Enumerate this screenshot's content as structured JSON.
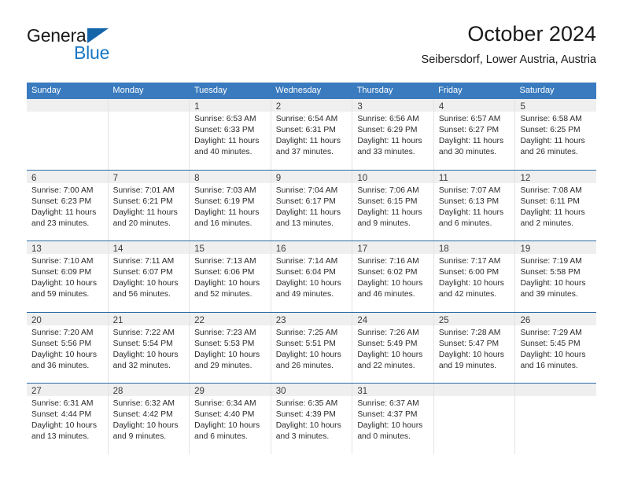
{
  "brand": {
    "name_part1": "General",
    "name_part2": "Blue",
    "accent_color": "#1777c4",
    "triangle_color": "#1464aa"
  },
  "header": {
    "title": "October 2024",
    "subtitle": "Seibersdorf, Lower Austria, Austria"
  },
  "calendar": {
    "header_bg": "#3a7bbf",
    "row_border_color": "#2d6ca8",
    "weekdays": [
      "Sunday",
      "Monday",
      "Tuesday",
      "Wednesday",
      "Thursday",
      "Friday",
      "Saturday"
    ],
    "weeks": [
      [
        {
          "day": "",
          "sunrise": "",
          "sunset": "",
          "daylight_line1": "",
          "daylight_line2": ""
        },
        {
          "day": "",
          "sunrise": "",
          "sunset": "",
          "daylight_line1": "",
          "daylight_line2": ""
        },
        {
          "day": "1",
          "sunrise": "Sunrise: 6:53 AM",
          "sunset": "Sunset: 6:33 PM",
          "daylight_line1": "Daylight: 11 hours",
          "daylight_line2": "and 40 minutes."
        },
        {
          "day": "2",
          "sunrise": "Sunrise: 6:54 AM",
          "sunset": "Sunset: 6:31 PM",
          "daylight_line1": "Daylight: 11 hours",
          "daylight_line2": "and 37 minutes."
        },
        {
          "day": "3",
          "sunrise": "Sunrise: 6:56 AM",
          "sunset": "Sunset: 6:29 PM",
          "daylight_line1": "Daylight: 11 hours",
          "daylight_line2": "and 33 minutes."
        },
        {
          "day": "4",
          "sunrise": "Sunrise: 6:57 AM",
          "sunset": "Sunset: 6:27 PM",
          "daylight_line1": "Daylight: 11 hours",
          "daylight_line2": "and 30 minutes."
        },
        {
          "day": "5",
          "sunrise": "Sunrise: 6:58 AM",
          "sunset": "Sunset: 6:25 PM",
          "daylight_line1": "Daylight: 11 hours",
          "daylight_line2": "and 26 minutes."
        }
      ],
      [
        {
          "day": "6",
          "sunrise": "Sunrise: 7:00 AM",
          "sunset": "Sunset: 6:23 PM",
          "daylight_line1": "Daylight: 11 hours",
          "daylight_line2": "and 23 minutes."
        },
        {
          "day": "7",
          "sunrise": "Sunrise: 7:01 AM",
          "sunset": "Sunset: 6:21 PM",
          "daylight_line1": "Daylight: 11 hours",
          "daylight_line2": "and 20 minutes."
        },
        {
          "day": "8",
          "sunrise": "Sunrise: 7:03 AM",
          "sunset": "Sunset: 6:19 PM",
          "daylight_line1": "Daylight: 11 hours",
          "daylight_line2": "and 16 minutes."
        },
        {
          "day": "9",
          "sunrise": "Sunrise: 7:04 AM",
          "sunset": "Sunset: 6:17 PM",
          "daylight_line1": "Daylight: 11 hours",
          "daylight_line2": "and 13 minutes."
        },
        {
          "day": "10",
          "sunrise": "Sunrise: 7:06 AM",
          "sunset": "Sunset: 6:15 PM",
          "daylight_line1": "Daylight: 11 hours",
          "daylight_line2": "and 9 minutes."
        },
        {
          "day": "11",
          "sunrise": "Sunrise: 7:07 AM",
          "sunset": "Sunset: 6:13 PM",
          "daylight_line1": "Daylight: 11 hours",
          "daylight_line2": "and 6 minutes."
        },
        {
          "day": "12",
          "sunrise": "Sunrise: 7:08 AM",
          "sunset": "Sunset: 6:11 PM",
          "daylight_line1": "Daylight: 11 hours",
          "daylight_line2": "and 2 minutes."
        }
      ],
      [
        {
          "day": "13",
          "sunrise": "Sunrise: 7:10 AM",
          "sunset": "Sunset: 6:09 PM",
          "daylight_line1": "Daylight: 10 hours",
          "daylight_line2": "and 59 minutes."
        },
        {
          "day": "14",
          "sunrise": "Sunrise: 7:11 AM",
          "sunset": "Sunset: 6:07 PM",
          "daylight_line1": "Daylight: 10 hours",
          "daylight_line2": "and 56 minutes."
        },
        {
          "day": "15",
          "sunrise": "Sunrise: 7:13 AM",
          "sunset": "Sunset: 6:06 PM",
          "daylight_line1": "Daylight: 10 hours",
          "daylight_line2": "and 52 minutes."
        },
        {
          "day": "16",
          "sunrise": "Sunrise: 7:14 AM",
          "sunset": "Sunset: 6:04 PM",
          "daylight_line1": "Daylight: 10 hours",
          "daylight_line2": "and 49 minutes."
        },
        {
          "day": "17",
          "sunrise": "Sunrise: 7:16 AM",
          "sunset": "Sunset: 6:02 PM",
          "daylight_line1": "Daylight: 10 hours",
          "daylight_line2": "and 46 minutes."
        },
        {
          "day": "18",
          "sunrise": "Sunrise: 7:17 AM",
          "sunset": "Sunset: 6:00 PM",
          "daylight_line1": "Daylight: 10 hours",
          "daylight_line2": "and 42 minutes."
        },
        {
          "day": "19",
          "sunrise": "Sunrise: 7:19 AM",
          "sunset": "Sunset: 5:58 PM",
          "daylight_line1": "Daylight: 10 hours",
          "daylight_line2": "and 39 minutes."
        }
      ],
      [
        {
          "day": "20",
          "sunrise": "Sunrise: 7:20 AM",
          "sunset": "Sunset: 5:56 PM",
          "daylight_line1": "Daylight: 10 hours",
          "daylight_line2": "and 36 minutes."
        },
        {
          "day": "21",
          "sunrise": "Sunrise: 7:22 AM",
          "sunset": "Sunset: 5:54 PM",
          "daylight_line1": "Daylight: 10 hours",
          "daylight_line2": "and 32 minutes."
        },
        {
          "day": "22",
          "sunrise": "Sunrise: 7:23 AM",
          "sunset": "Sunset: 5:53 PM",
          "daylight_line1": "Daylight: 10 hours",
          "daylight_line2": "and 29 minutes."
        },
        {
          "day": "23",
          "sunrise": "Sunrise: 7:25 AM",
          "sunset": "Sunset: 5:51 PM",
          "daylight_line1": "Daylight: 10 hours",
          "daylight_line2": "and 26 minutes."
        },
        {
          "day": "24",
          "sunrise": "Sunrise: 7:26 AM",
          "sunset": "Sunset: 5:49 PM",
          "daylight_line1": "Daylight: 10 hours",
          "daylight_line2": "and 22 minutes."
        },
        {
          "day": "25",
          "sunrise": "Sunrise: 7:28 AM",
          "sunset": "Sunset: 5:47 PM",
          "daylight_line1": "Daylight: 10 hours",
          "daylight_line2": "and 19 minutes."
        },
        {
          "day": "26",
          "sunrise": "Sunrise: 7:29 AM",
          "sunset": "Sunset: 5:45 PM",
          "daylight_line1": "Daylight: 10 hours",
          "daylight_line2": "and 16 minutes."
        }
      ],
      [
        {
          "day": "27",
          "sunrise": "Sunrise: 6:31 AM",
          "sunset": "Sunset: 4:44 PM",
          "daylight_line1": "Daylight: 10 hours",
          "daylight_line2": "and 13 minutes."
        },
        {
          "day": "28",
          "sunrise": "Sunrise: 6:32 AM",
          "sunset": "Sunset: 4:42 PM",
          "daylight_line1": "Daylight: 10 hours",
          "daylight_line2": "and 9 minutes."
        },
        {
          "day": "29",
          "sunrise": "Sunrise: 6:34 AM",
          "sunset": "Sunset: 4:40 PM",
          "daylight_line1": "Daylight: 10 hours",
          "daylight_line2": "and 6 minutes."
        },
        {
          "day": "30",
          "sunrise": "Sunrise: 6:35 AM",
          "sunset": "Sunset: 4:39 PM",
          "daylight_line1": "Daylight: 10 hours",
          "daylight_line2": "and 3 minutes."
        },
        {
          "day": "31",
          "sunrise": "Sunrise: 6:37 AM",
          "sunset": "Sunset: 4:37 PM",
          "daylight_line1": "Daylight: 10 hours",
          "daylight_line2": "and 0 minutes."
        },
        {
          "day": "",
          "sunrise": "",
          "sunset": "",
          "daylight_line1": "",
          "daylight_line2": ""
        },
        {
          "day": "",
          "sunrise": "",
          "sunset": "",
          "daylight_line1": "",
          "daylight_line2": ""
        }
      ]
    ]
  }
}
